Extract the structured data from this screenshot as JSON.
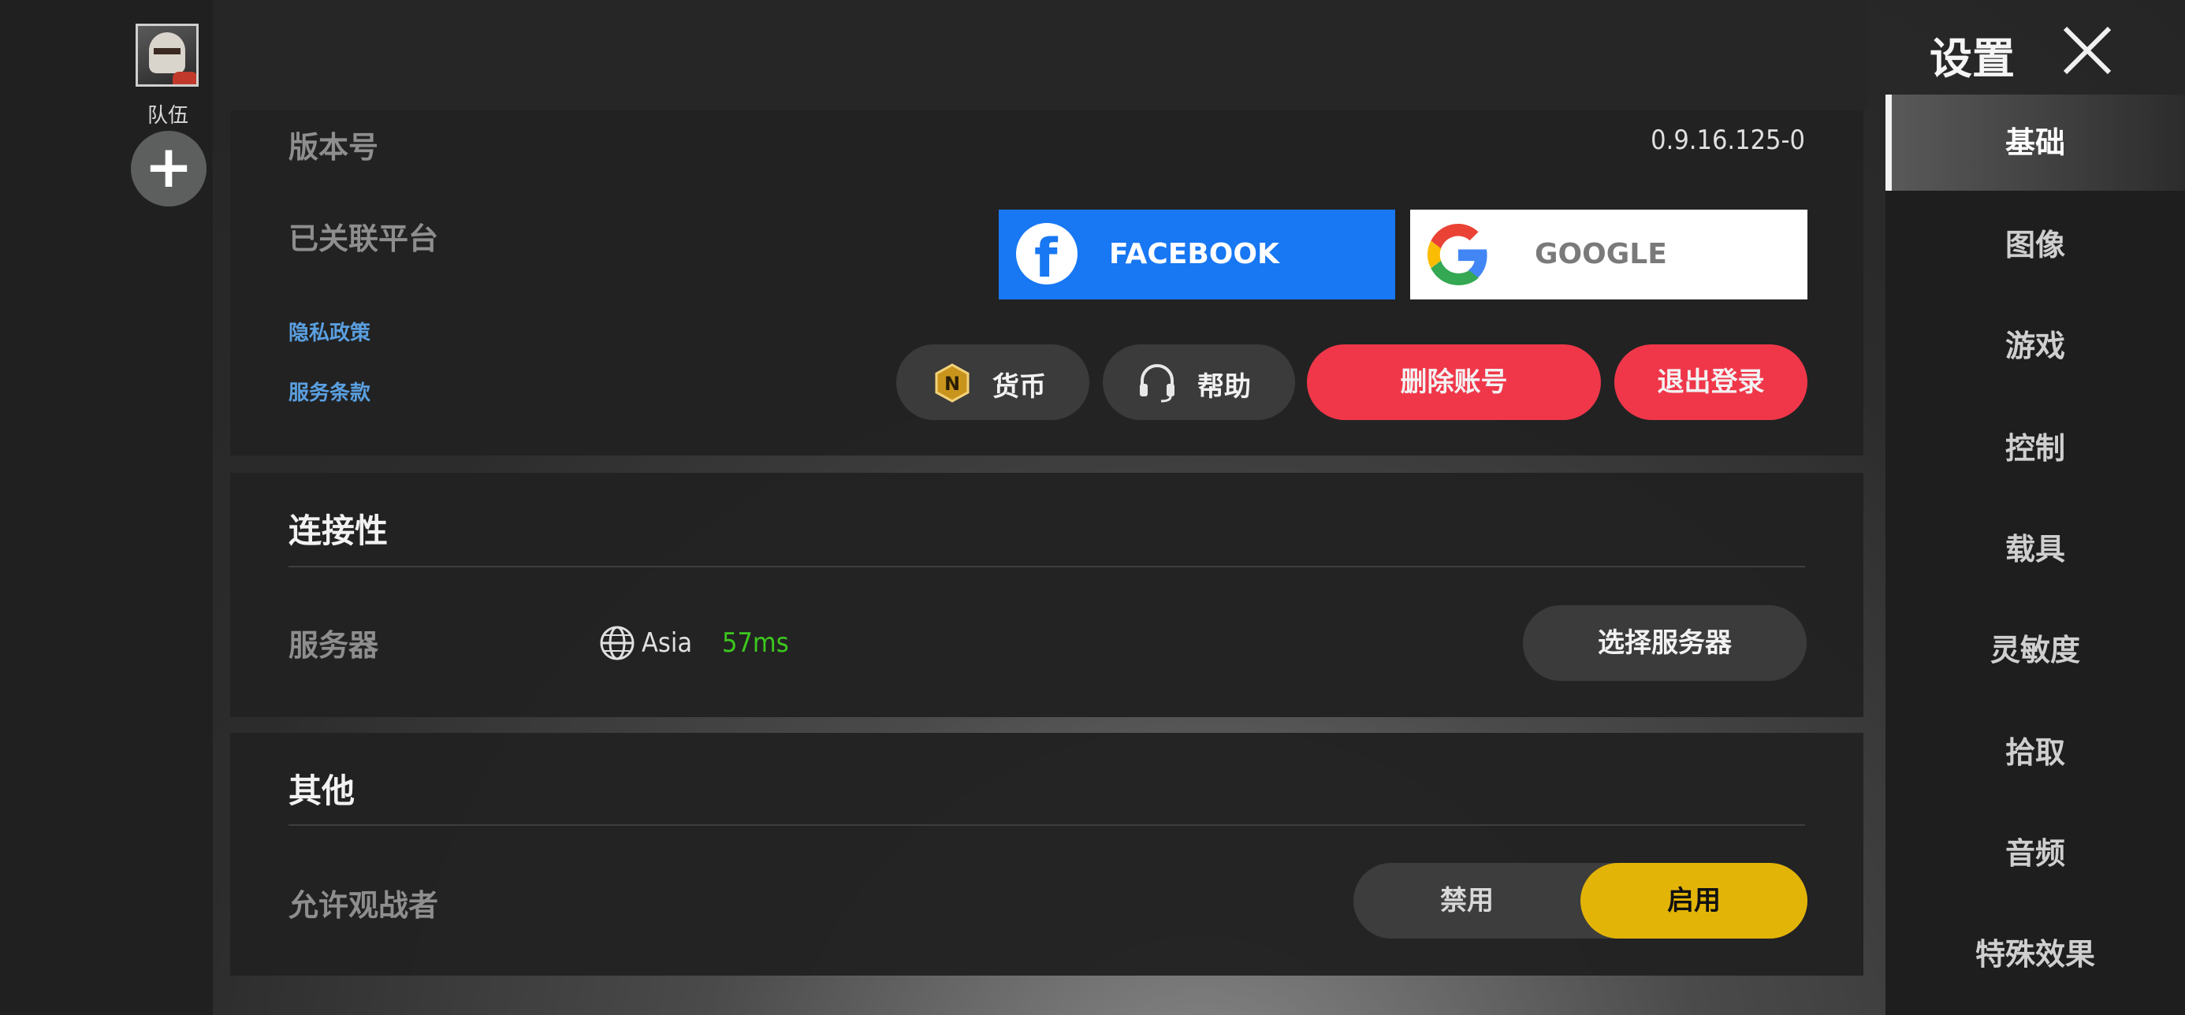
{
  "header": {
    "title": "设置"
  },
  "team": {
    "label": "队伍"
  },
  "account": {
    "version_label": "版本号",
    "version_value": "0.9.16.125-0",
    "linked_label": "已关联平台",
    "facebook_label": "FACEBOOK",
    "google_label": "GOOGLE",
    "privacy_link": "隐私政策",
    "terms_link": "服务条款",
    "currency_label": "货币",
    "help_label": "帮助",
    "delete_account_label": "删除账号",
    "logout_label": "退出登录"
  },
  "connectivity": {
    "title": "连接性",
    "server_label": "服务器",
    "region": "Asia",
    "ping": "57ms",
    "select_server_label": "选择服务器"
  },
  "other": {
    "title": "其他",
    "spectator_label": "允许观战者",
    "toggle_off_label": "禁用",
    "toggle_on_label": "启用",
    "selected": "启用"
  },
  "sidebar": {
    "items": [
      {
        "label": "基础",
        "active": true
      },
      {
        "label": "图像"
      },
      {
        "label": "游戏"
      },
      {
        "label": "控制"
      },
      {
        "label": "载具"
      },
      {
        "label": "灵敏度"
      },
      {
        "label": "拾取"
      },
      {
        "label": "音频"
      },
      {
        "label": "特殊效果"
      }
    ]
  },
  "colors": {
    "facebook_blue": "#1877f2",
    "danger_red": "#f0374a",
    "toggle_on_yellow": "#e3b408",
    "ping_green": "#3cc81e",
    "link_blue": "#5a9fe0"
  },
  "icons": [
    "close-icon",
    "facebook-logo-icon",
    "google-logo-icon",
    "currency-coin-icon",
    "headset-icon",
    "globe-icon",
    "plus-icon"
  ]
}
